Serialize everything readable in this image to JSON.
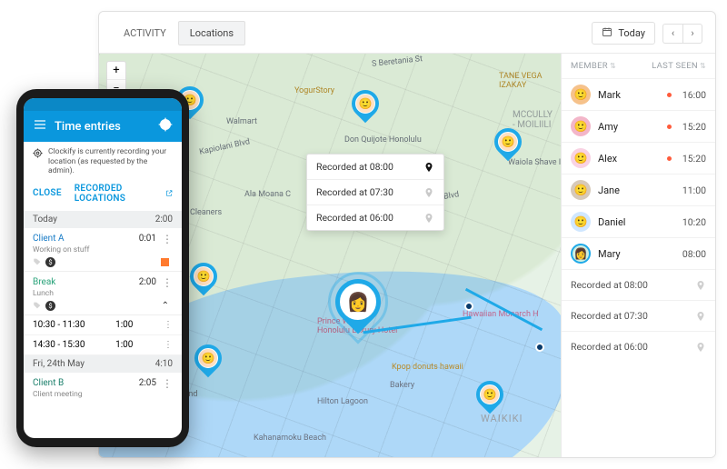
{
  "dashboard": {
    "tabs": {
      "activity": "ACTIVITY",
      "locations": "Locations"
    },
    "date_label": "Today",
    "members_header": {
      "member": "MEMBER",
      "last_seen": "LAST SEEN"
    },
    "members": [
      {
        "name": "Mark",
        "time": "16:00",
        "live": true,
        "color": "#f6c28b"
      },
      {
        "name": "Amy",
        "time": "15:20",
        "live": true,
        "color": "#f3b6c9"
      },
      {
        "name": "Alex",
        "time": "15:20",
        "live": true,
        "color": "#f9d2e3"
      },
      {
        "name": "Jane",
        "time": "11:00",
        "live": false,
        "color": "#d7c9b8"
      },
      {
        "name": "Daniel",
        "time": "10:20",
        "live": false,
        "color": "#d0e7ff"
      },
      {
        "name": "Mary",
        "time": "08:00",
        "live": false,
        "color": "#cfeee0"
      }
    ],
    "recorded_side": [
      "Recorded at 08:00",
      "Recorded at 07:30",
      "Recorded at 06:00"
    ],
    "popover": [
      {
        "label": "Recorded at 08:00",
        "active": true
      },
      {
        "label": "Recorded at 07:30",
        "active": false
      },
      {
        "label": "Recorded at 06:00",
        "active": false
      }
    ],
    "map_labels": {
      "yogur": "YogurStory",
      "walmart": "Walmart",
      "donq": "Don Quijote Honolulu",
      "ala": "Ala Moana C",
      "hotel": "Prince Waik\nHonolulu Luxury Hotel",
      "kpop": "Kpop donuts hawaii",
      "hawaiian": "Hawaiian Monarch H",
      "hilton": "Hilton Lagoon",
      "waiola": "Waiola Shave Ice",
      "mccully": "MCCULLY\n- MOILIILI",
      "tane": "TANE VEGA\nIZAKAY",
      "kahana": "Kahanamoku Beach",
      "waikiki": "WAIKIKI",
      "bakery": "Bakery",
      "kap": "Kapiolani Blvd",
      "gic": "gic Island\nagoon",
      "ber": "S Beretania St",
      "cleaners": "Cleaners",
      "blvd2": "Kapiolani Blvd"
    }
  },
  "phone": {
    "title": "Time entries",
    "notice": "Clockify is currently recording your location (as requested by the admin).",
    "actions": {
      "close": "CLOSE",
      "recorded": "RECORDED LOCATIONS"
    },
    "today_label": "Today",
    "today_total": "2:00",
    "entry_a": {
      "label": "Client A",
      "sub": "Working on stuff",
      "dur": "0:01"
    },
    "entry_break": {
      "label": "Break",
      "sub": "Lunch",
      "dur": "2:00"
    },
    "sub1": {
      "range": "10:30 - 11:30",
      "dur": "1:00"
    },
    "sub2": {
      "range": "14:30 - 15:30",
      "dur": "1:00"
    },
    "day2_label": "Fri, 24th May",
    "day2_total": "4:10",
    "entry_b": {
      "label": "Client B",
      "sub": "Client meeting",
      "dur": "2:05"
    }
  }
}
